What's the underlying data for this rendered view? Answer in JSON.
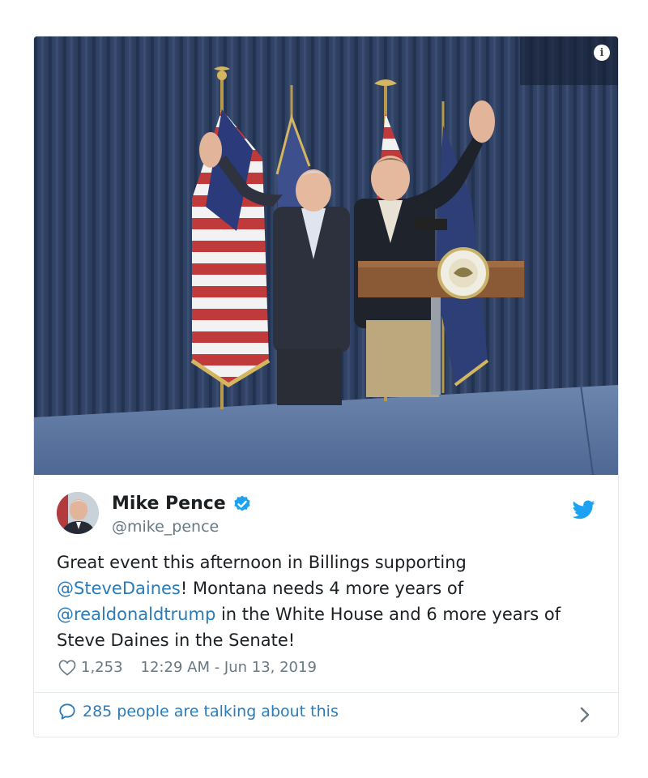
{
  "tweet": {
    "author_name": "Mike Pence",
    "author_handle": "@mike_pence",
    "verified": true,
    "text_before": "Great event this afternoon in Billings supporting ",
    "mention_1": "@SteveDaines",
    "text_middle": "! Montana needs 4 more years of ",
    "mention_2": "@realdonaldtrump",
    "text_after": " in the White House and 6 more years of Steve Daines in the Senate!",
    "likes": "1,253",
    "timestamp": "12:29 AM - Jun 13, 2019",
    "talking": "285 people are talking about this"
  },
  "media": {
    "info_label": "i"
  },
  "colors": {
    "link": "#2b7bb9",
    "verified": "#1da1f2",
    "muted": "#697882",
    "border": "#e1e8ed"
  },
  "icons": [
    "info-icon",
    "verified-badge-icon",
    "twitter-bird-icon",
    "heart-icon",
    "speech-bubble-icon",
    "chevron-right-icon"
  ]
}
